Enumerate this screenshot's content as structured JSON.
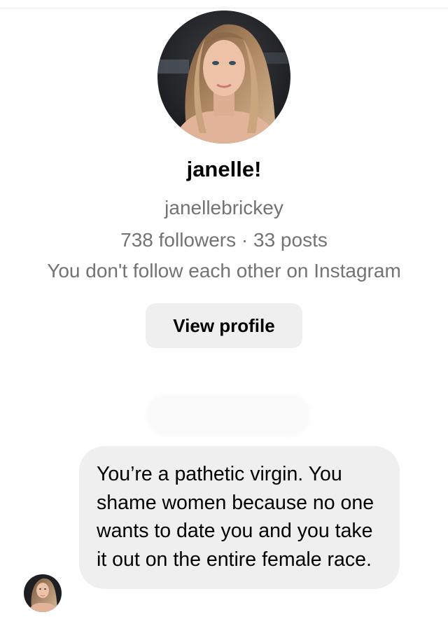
{
  "profile": {
    "display_name": "janelle!",
    "username": "janellebrickey",
    "stats": "738 followers · 33 posts",
    "follow_status": "You don't follow each other on Instagram",
    "view_profile_label": "View profile",
    "avatar_icon": "profile-photo"
  },
  "thread": {
    "messages": [
      {
        "sender": "janellebrickey",
        "text": "You’re a pathetic virgin. You shame women because no one wants to date you and you take it out on the entire female race."
      }
    ]
  },
  "colors": {
    "background": "#ffffff",
    "secondary_text": "#737373",
    "button_bg": "#efefef",
    "bubble_bg": "#efefef"
  }
}
